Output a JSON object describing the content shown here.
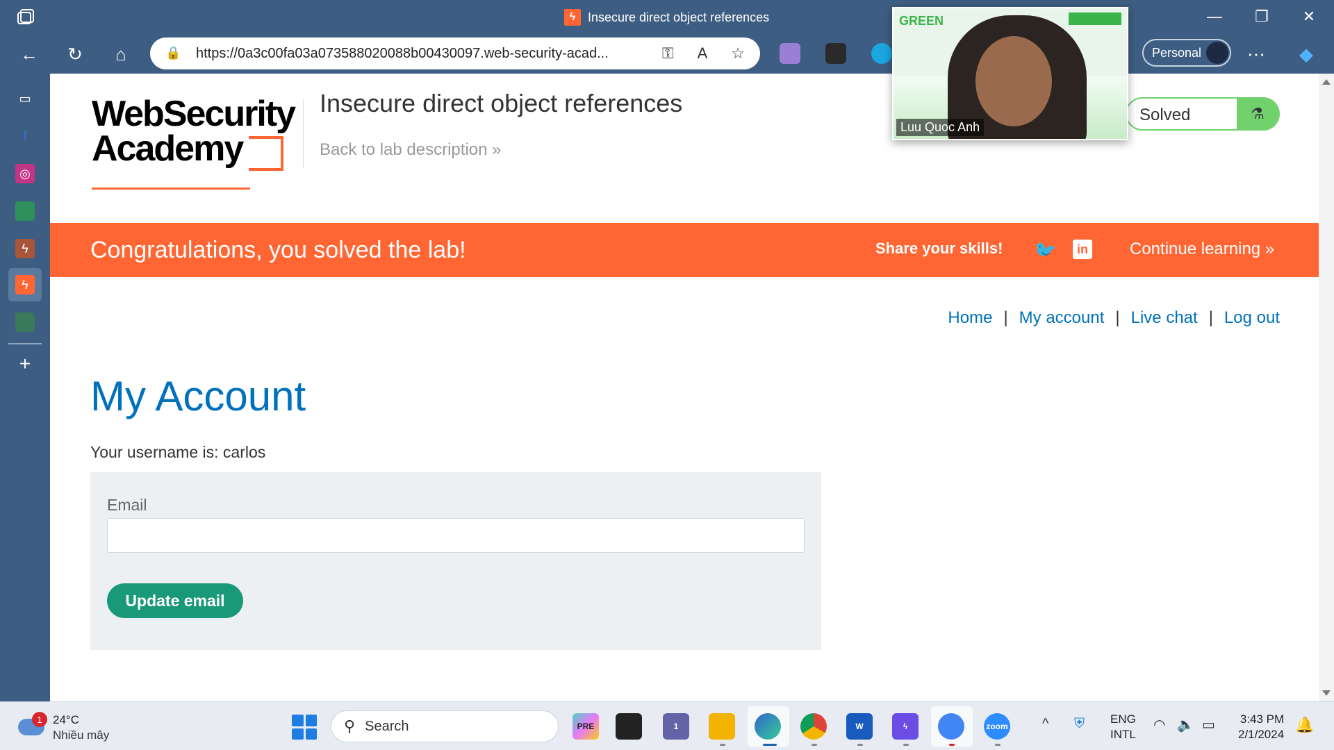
{
  "browser": {
    "window_title": "Insecure direct object references",
    "url": "https://0a3c00fa03a073588020088b00430097.web-security-acad...",
    "profile_label": "Personal"
  },
  "lab": {
    "logo_line1": "WebSecurity",
    "logo_line2": "Academy",
    "title": "Insecure direct object references",
    "back_link": "Back to lab description",
    "back_chevron": "»",
    "status": "Solved"
  },
  "banner": {
    "message": "Congratulations, you solved the lab!",
    "share": "Share your skills!",
    "linkedin_glyph": "in",
    "continue": "Continue learning »"
  },
  "nav": {
    "home": "Home",
    "my_account": "My account",
    "live_chat": "Live chat",
    "log_out": "Log out",
    "separator": "|"
  },
  "account": {
    "heading": "My Account",
    "username_text": "Your username is: carlos",
    "email_label": "Email",
    "email_value": "",
    "update_button": "Update email"
  },
  "video": {
    "participant_name": "Luu Quoc Anh"
  },
  "taskbar": {
    "weather_badge": "1",
    "temperature": "24°C",
    "weather_desc": "Nhiều mây",
    "search_placeholder": "Search",
    "teams_badge": "1",
    "copilot_badge": "PRE",
    "zoom_label": "zoom",
    "lang_line1": "ENG",
    "lang_line2": "INTL",
    "time": "3:43 PM",
    "date": "2/1/2024"
  },
  "colors": {
    "accent_orange": "#ff6633",
    "link_blue": "#0071bc",
    "solved_green": "#70d16d",
    "button_teal": "#1a9978"
  }
}
